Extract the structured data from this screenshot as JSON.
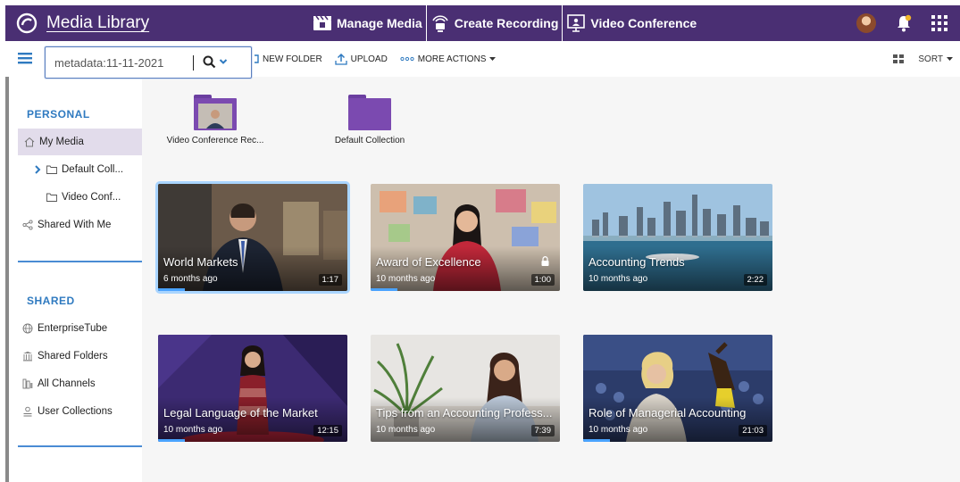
{
  "app": {
    "title": "Media Library",
    "colors": {
      "header": "#4a2f73",
      "accent": "#2f7ac0",
      "folder": "#7b4ab0",
      "active_bg": "#e2dceb"
    }
  },
  "topnav": {
    "items": [
      {
        "label": "Manage Media",
        "icon": "clapperboard-icon"
      },
      {
        "label": "Create Recording",
        "icon": "webcam-icon"
      },
      {
        "label": "Video Conference",
        "icon": "presentation-screen-icon"
      }
    ]
  },
  "search": {
    "value": "metadata:11-11-2021"
  },
  "toolbar": {
    "new_folder": "NEW FOLDER",
    "upload": "UPLOAD",
    "more_actions": "MORE ACTIONS",
    "sort": "SORT"
  },
  "sidebar": {
    "personal_title": "PERSONAL",
    "personal_items": [
      {
        "label": "My Media",
        "icon": "home-icon",
        "active": true
      },
      {
        "label": "Default Coll...",
        "icon": "folder-outline-icon",
        "expander": true
      },
      {
        "label": "Video Conf...",
        "icon": "folder-outline-icon"
      },
      {
        "label": "Shared With Me",
        "icon": "share-icon"
      }
    ],
    "shared_title": "SHARED",
    "shared_items": [
      {
        "label": "EnterpriseTube",
        "icon": "globe-icon"
      },
      {
        "label": "Shared Folders",
        "icon": "building-icon"
      },
      {
        "label": "All Channels",
        "icon": "channels-icon"
      },
      {
        "label": "User Collections",
        "icon": "user-collection-icon"
      }
    ]
  },
  "folders": [
    {
      "name": "Video Conference Rec...",
      "has_thumb": true
    },
    {
      "name": "Default Collection",
      "has_thumb": false
    }
  ],
  "videos": [
    {
      "title": "World Markets",
      "age": "6 months ago",
      "duration": "1:17",
      "locked": false,
      "selected": true
    },
    {
      "title": "Award of Excellence",
      "age": "10 months ago",
      "duration": "1:00",
      "locked": true,
      "selected": false
    },
    {
      "title": "Accounting Trends",
      "age": "10 months ago",
      "duration": "2:22",
      "locked": false,
      "selected": false
    },
    {
      "title": "Legal Language of the Market",
      "age": "10 months ago",
      "duration": "12:15",
      "locked": false,
      "selected": false
    },
    {
      "title": "Tips from an Accounting Profess...",
      "age": "10 months ago",
      "duration": "7:39",
      "locked": false,
      "selected": false
    },
    {
      "title": "Role of Managerial Accounting",
      "age": "10 months ago",
      "duration": "21:03",
      "locked": false,
      "selected": false
    }
  ]
}
